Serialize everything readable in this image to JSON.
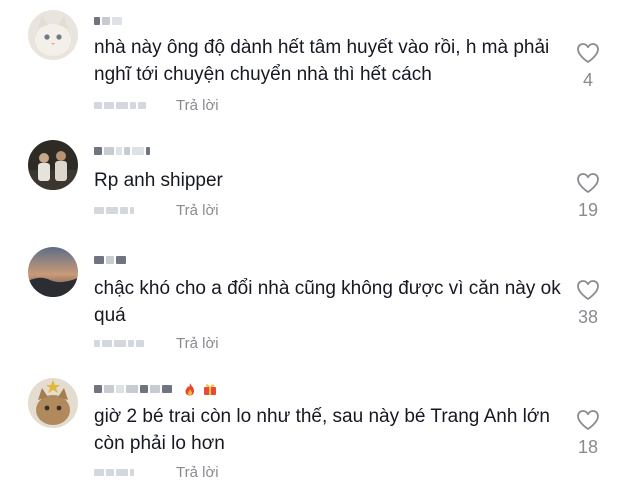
{
  "comments": [
    {
      "text": "nhà này ông độ dành hết tâm huyết vào rồi, h mà phải nghĩ tới chuyện chuyển nhà thì hết cách",
      "reply_label": "Trả lời",
      "like_count": "4",
      "avatar_icon": "cat-avatar"
    },
    {
      "text": "Rp anh shipper",
      "reply_label": "Trả lời",
      "like_count": "19",
      "avatar_icon": "group-photo-avatar"
    },
    {
      "text": "chậc khó cho a đổi nhà cũng không được vì căn này ok quá",
      "reply_label": "Trả lời",
      "like_count": "38",
      "avatar_icon": "sunset-avatar"
    },
    {
      "text": "giờ 2 bé trai còn lo như thế, sau này bé Trang Anh lớn còn phải lo hơn",
      "reply_label": "Trả lời",
      "like_count": "18",
      "avatar_icon": "cat-christmas-avatar"
    }
  ],
  "icons": {
    "like": "heart-outline-icon"
  },
  "colors": {
    "text": "#161823",
    "secondary": "#8a8b91",
    "background": "#ffffff"
  }
}
